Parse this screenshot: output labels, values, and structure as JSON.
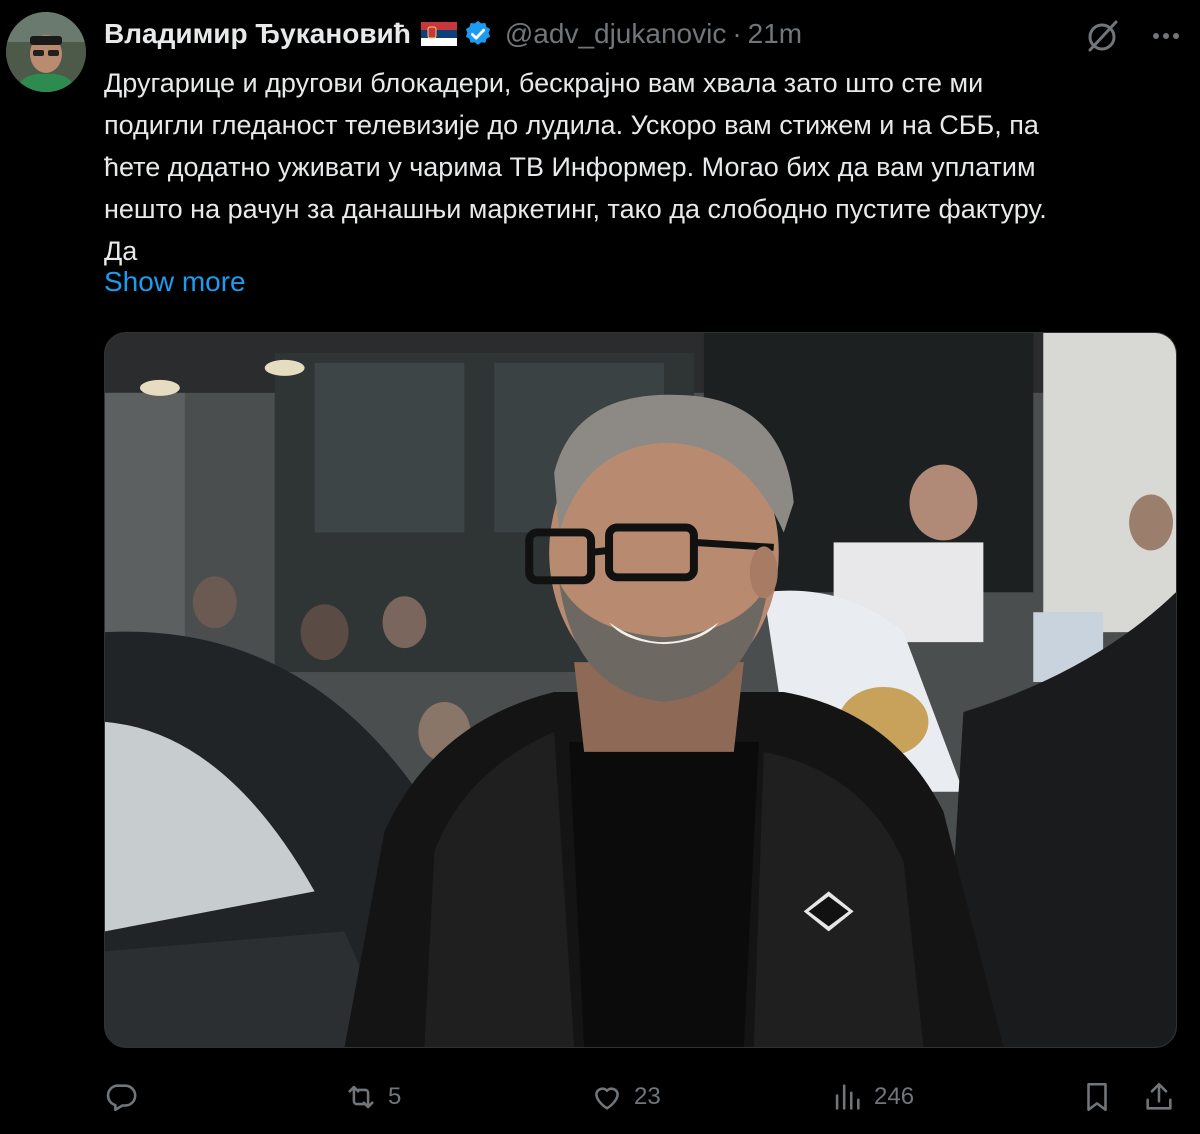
{
  "author": {
    "display_name": "Владимир Ђукановић",
    "handle": "@adv_djukanovic",
    "separator": "·",
    "time": "21m"
  },
  "tweet": {
    "lines": [
      "Другарице и другови блокадери, бескрајно вам хвала зато што сте ми",
      "подигли гледаност телевизије до лудила. Ускоро вам стижем и на СББ, па",
      "ћете додатно уживати у чарима ТВ Информер. Могао бих да вам уплатим",
      "нешто на рачун за данашњи маркетинг, тако да слободно пустите фактуру.",
      "Да"
    ],
    "show_more": "Show more"
  },
  "actions": {
    "replies": "",
    "reposts": "5",
    "likes": "23",
    "views": "246"
  },
  "icons": {
    "flag": "serbia-flag-icon",
    "verified": "verified-badge-icon",
    "grok": "grok-icon",
    "more": "more-icon",
    "reply": "reply-icon",
    "repost": "repost-icon",
    "like": "like-icon",
    "views": "views-icon",
    "bookmark": "bookmark-icon",
    "share": "share-icon"
  },
  "colors": {
    "background": "#000000",
    "text": "#e7e9ea",
    "muted": "#71767b",
    "accent": "#1d9bf0"
  }
}
